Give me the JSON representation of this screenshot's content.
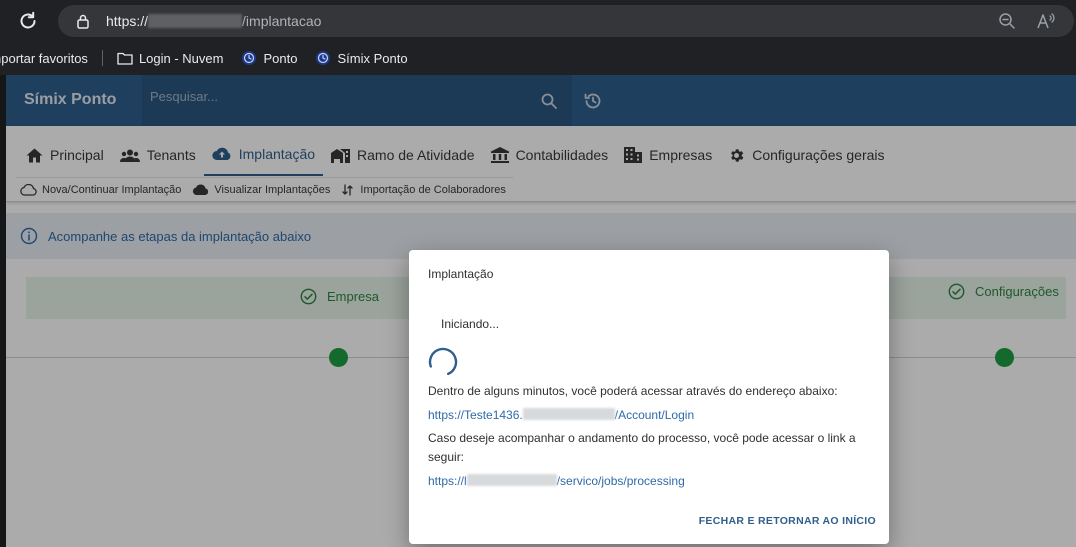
{
  "browser": {
    "url_prefix": "https://",
    "url_suffix": "/implantacao",
    "bookmarks": {
      "import_label": "nportar favoritos",
      "items": [
        {
          "label": "Login - Nuvem"
        },
        {
          "label": "Ponto"
        },
        {
          "label": "Símix Ponto"
        }
      ]
    }
  },
  "app": {
    "brand": "Símix Ponto",
    "search": {
      "placeholder": "Pesquisar..."
    },
    "tabs": [
      {
        "label": "Principal"
      },
      {
        "label": "Tenants"
      },
      {
        "label": "Implantação"
      },
      {
        "label": "Ramo de Atividade"
      },
      {
        "label": "Contabilidades"
      },
      {
        "label": "Empresas"
      },
      {
        "label": "Configurações gerais"
      }
    ],
    "subtabs": [
      {
        "label": "Nova/Continuar Implantação"
      },
      {
        "label": "Visualizar Implantações"
      },
      {
        "label": "Importação de Colaboradores"
      }
    ],
    "alert": "Acompanhe as etapas da implantação abaixo",
    "steps": [
      {
        "label": "Empresa"
      },
      {
        "label": "Configurações"
      }
    ]
  },
  "dialog": {
    "title": "Implantação",
    "status": "Iniciando...",
    "message1": "Dentro de alguns minutos, você poderá acessar através do endereço abaixo:",
    "link1_prefix": "https://Teste1436.",
    "link1_suffix": "/Account/Login",
    "message2": "Caso deseje acompanhar o andamento do processo, você pode acessar o link a seguir:",
    "link2_prefix": "https://l",
    "link2_suffix": "/servico/jobs/processing",
    "action": "FECHAR E RETORNAR AO INÍCIO"
  },
  "colors": {
    "header": "#2f5f8c",
    "accent": "#2f6aa8",
    "success": "#1f9d42"
  }
}
